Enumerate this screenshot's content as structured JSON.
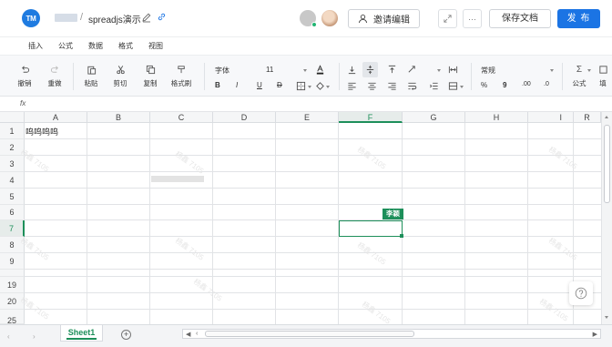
{
  "header": {
    "logo_text": "TM",
    "breadcrumb_sep": "/",
    "doc_title": "spreadjs演示",
    "invite_label": "邀请编辑",
    "more_label": "···",
    "save_label": "保存文档",
    "publish_label": "发 布"
  },
  "menu": {
    "items": [
      "插入",
      "公式",
      "数据",
      "格式",
      "视图"
    ]
  },
  "toolbar": {
    "undo_label": "撤销",
    "redo_label": "重做",
    "paste_label": "粘贴",
    "cut_label": "剪切",
    "copy_label": "复制",
    "format_painter_label": "格式刷",
    "font_family": "字体",
    "font_size": "11",
    "bold": "B",
    "italic": "I",
    "underline": "U",
    "strike": "D",
    "number_format": "常规",
    "percent": "%",
    "comma": "9",
    "dec_inc": ".00",
    "dec_dec": ".0",
    "formula_label": "公式",
    "fill_label": "填"
  },
  "formula_bar": {
    "fx": "fx"
  },
  "grid": {
    "columns": [
      "A",
      "B",
      "C",
      "D",
      "E",
      "F",
      "G",
      "H",
      "I",
      "R"
    ],
    "rows": [
      "1",
      "2",
      "3",
      "4",
      "5",
      "6",
      "7",
      "8",
      "9",
      "19",
      "20",
      "25"
    ],
    "cell_a1": "呜呜呜呜",
    "collab_user": "李颖",
    "watermark": "杨鑫 7105"
  },
  "footer": {
    "sheet_name": "Sheet1",
    "add_sheet": "+",
    "prev_arrow": "‹",
    "next_arrow": "›"
  },
  "colors": {
    "brand_blue": "#1b74e4",
    "selection_green": "#1d8f5a"
  }
}
